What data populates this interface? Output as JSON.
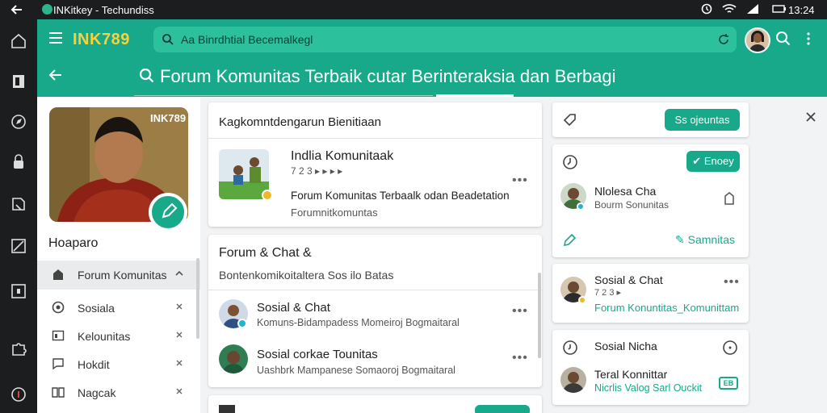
{
  "statusbar": {
    "title": "INKitkey - Techundiss",
    "time": "13:24"
  },
  "header": {
    "brand": "INK789",
    "search_placeholder": "Aa Binrdhtial Becemalkegl",
    "page_title": "Forum Komunitas Terbaik cutar Berinteraksia dan Berbagi"
  },
  "profile": {
    "photo_tag": "INK789",
    "username": "Hoaparo",
    "menu": [
      {
        "label": "Forum Komunitas",
        "icon": "home-icon"
      },
      {
        "label": "Sosiala",
        "icon": "globe-icon"
      },
      {
        "label": "Kelounitas",
        "icon": "board-icon"
      },
      {
        "label": "Hokdit",
        "icon": "chat-icon"
      },
      {
        "label": "Nagcak",
        "icon": "book-icon"
      }
    ]
  },
  "main": {
    "card1": {
      "header": "Kagkomntdengarun Bienitiaan",
      "title": "Indlia Komunitaak",
      "meta": "7 2 3 ▸ ▸ ▸ ▸",
      "desc": "Forum Komunitas Terbaalk odan Beadetation",
      "sub": "Forumnitkomuntas"
    },
    "card2": {
      "title": "Forum & Chat &",
      "subtitle": "Bontenkomikoitaltera Sos ilo Batas",
      "items": [
        {
          "name": "Sosial & Chat",
          "desc": "Komuns-Bidampadess Momeiroj Bogmaitaral"
        },
        {
          "name": "Sosial corkae Tounitas",
          "desc": "Uashbrk Mampanese Somaoroj Bogmaitaral"
        }
      ]
    }
  },
  "right": {
    "card_a": {
      "button": "Ss ojeuntas"
    },
    "card_b": {
      "button": "Enoey",
      "name": "Nlolesa Cha",
      "sub": "Bourm Sonunitas",
      "footer_link": "Samnitas"
    },
    "card_c": {
      "name": "Sosial & Chat",
      "meta": "7 2 3 ▸",
      "link": "Forum Konuntitas_Komunittam"
    },
    "card_d": {
      "title": "Sosial Nicha",
      "name": "Teral Konnittar",
      "link": "Nicrlis Valog Sarl Ouckit",
      "badge": "EB"
    }
  },
  "colors": {
    "accent": "#17a98a",
    "brand_yellow": "#f7d23c",
    "rail": "#1b1d1f"
  }
}
